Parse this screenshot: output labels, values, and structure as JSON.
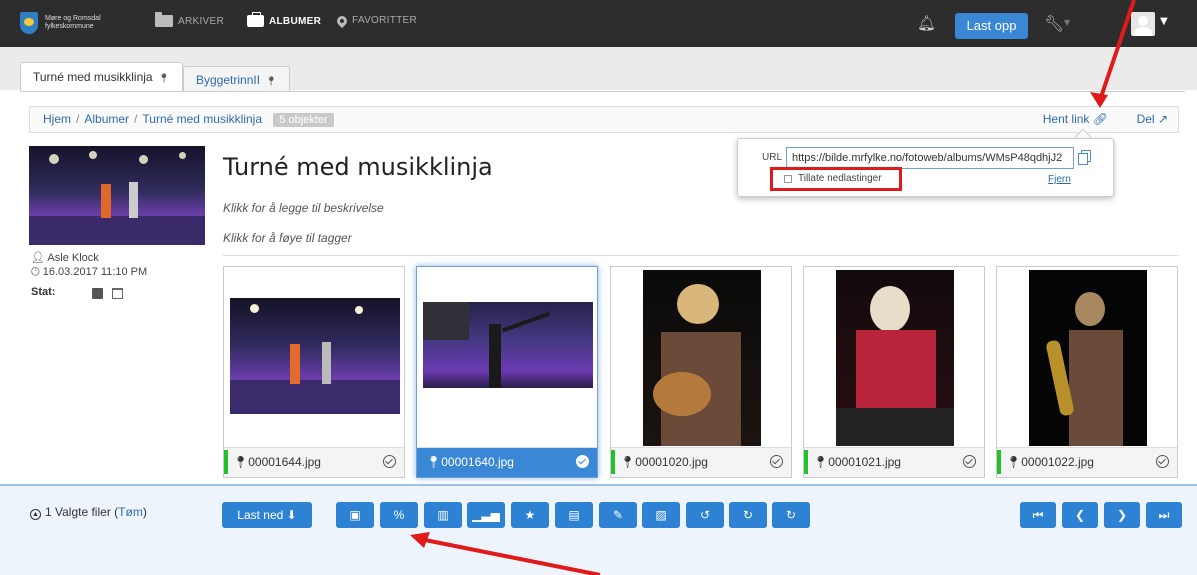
{
  "nav": {
    "logo_line1": "Møre og Romsdal",
    "logo_line2": "fylkeskommune",
    "items": [
      {
        "label": "ARKIVER"
      },
      {
        "label": "ALBUMER"
      },
      {
        "label": "FAVORITTER"
      }
    ],
    "upload_label": "Last opp"
  },
  "tabs": [
    {
      "label": "Turné med musikklinja"
    },
    {
      "label": "ByggetrinnII"
    }
  ],
  "breadcrumb": {
    "items": [
      "Hjem",
      "Albumer",
      "Turné med musikklinja"
    ],
    "separator": "/",
    "count_badge": "5 objekter",
    "get_link": "Hent link",
    "share": "Del"
  },
  "album": {
    "title": "Turné med musikklinja",
    "description_hint": "Klikk for å legge til beskrivelse",
    "tags_hint": "Klikk for å føye til tagger",
    "author": "Asle Klock",
    "date": "16.03.2017 11:10 PM",
    "stat_label": "Stat:"
  },
  "link_popover": {
    "url_label": "URL",
    "url_value": "https://bilde.mrfylke.no/fotoweb/albums/WMsP48qdhjJ2",
    "allow_downloads": "Tillate nedlastinger",
    "remove": "Fjern"
  },
  "images": [
    {
      "name": "00001644.jpg",
      "selected": false
    },
    {
      "name": "00001640.jpg",
      "selected": true
    },
    {
      "name": "00001020.jpg",
      "selected": false
    },
    {
      "name": "00001021.jpg",
      "selected": false
    },
    {
      "name": "00001022.jpg",
      "selected": false
    }
  ],
  "toolbar": {
    "selected_files": "1 Valgte filer",
    "clear": "Tøm",
    "download": "Last ned"
  },
  "colors": {
    "nav_bg": "#2d2d2d",
    "accent": "#2e82d4",
    "status_green": "#22c22a",
    "annotation_red": "#e01a1a"
  }
}
